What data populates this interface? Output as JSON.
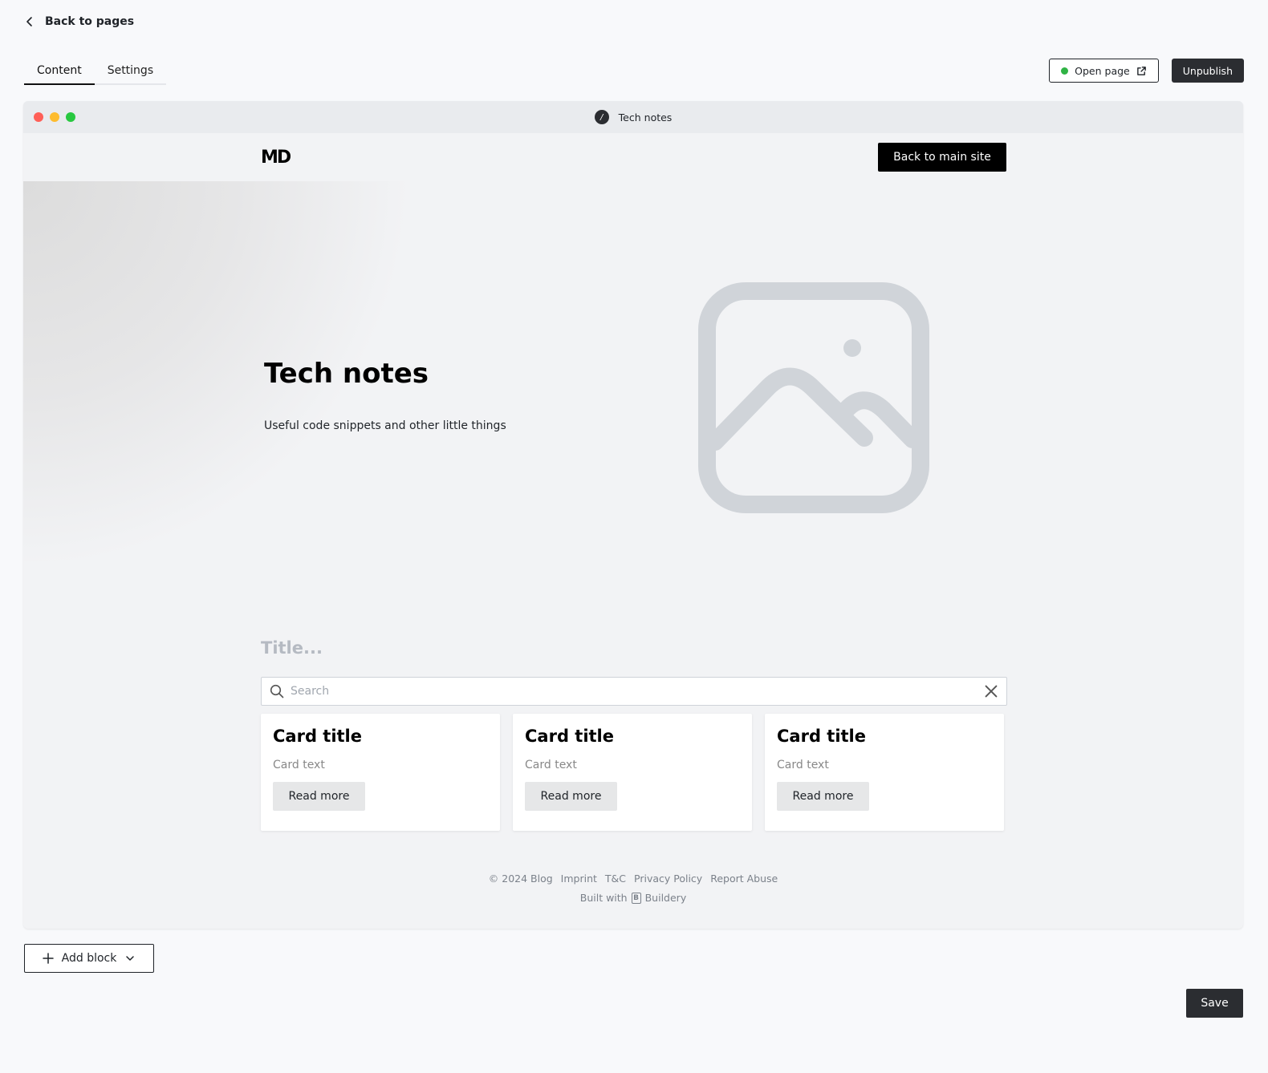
{
  "nav": {
    "back_label": "Back to pages"
  },
  "tabs": [
    {
      "label": "Content",
      "active": true
    },
    {
      "label": "Settings",
      "active": false
    }
  ],
  "actions": {
    "open_page_label": "Open page",
    "unpublish_label": "Unpublish"
  },
  "preview": {
    "window_title": "Tech notes",
    "logo_text": "MD",
    "back_main_label": "Back to main site",
    "hero": {
      "title": "Tech notes",
      "subtitle": "Useful code snippets and other little things"
    },
    "listing": {
      "title_placeholder": "Title...",
      "search_placeholder": "Search"
    },
    "cards": [
      {
        "title": "Card title",
        "text": "Card text",
        "button": "Read more"
      },
      {
        "title": "Card title",
        "text": "Card text",
        "button": "Read more"
      },
      {
        "title": "Card title",
        "text": "Card text",
        "button": "Read more"
      }
    ],
    "footer": {
      "links": [
        "© 2024 Blog",
        "Imprint",
        "T&C",
        "Privacy Policy",
        "Report Abuse"
      ],
      "built_with": "Built with",
      "brand": "Buildery"
    }
  },
  "bottom": {
    "add_block_label": "Add block",
    "save_label": "Save"
  },
  "colors": {
    "status_green": "#2fb344",
    "dark_button": "#2b2d31",
    "placeholder_icon": "#d0d4d9"
  }
}
